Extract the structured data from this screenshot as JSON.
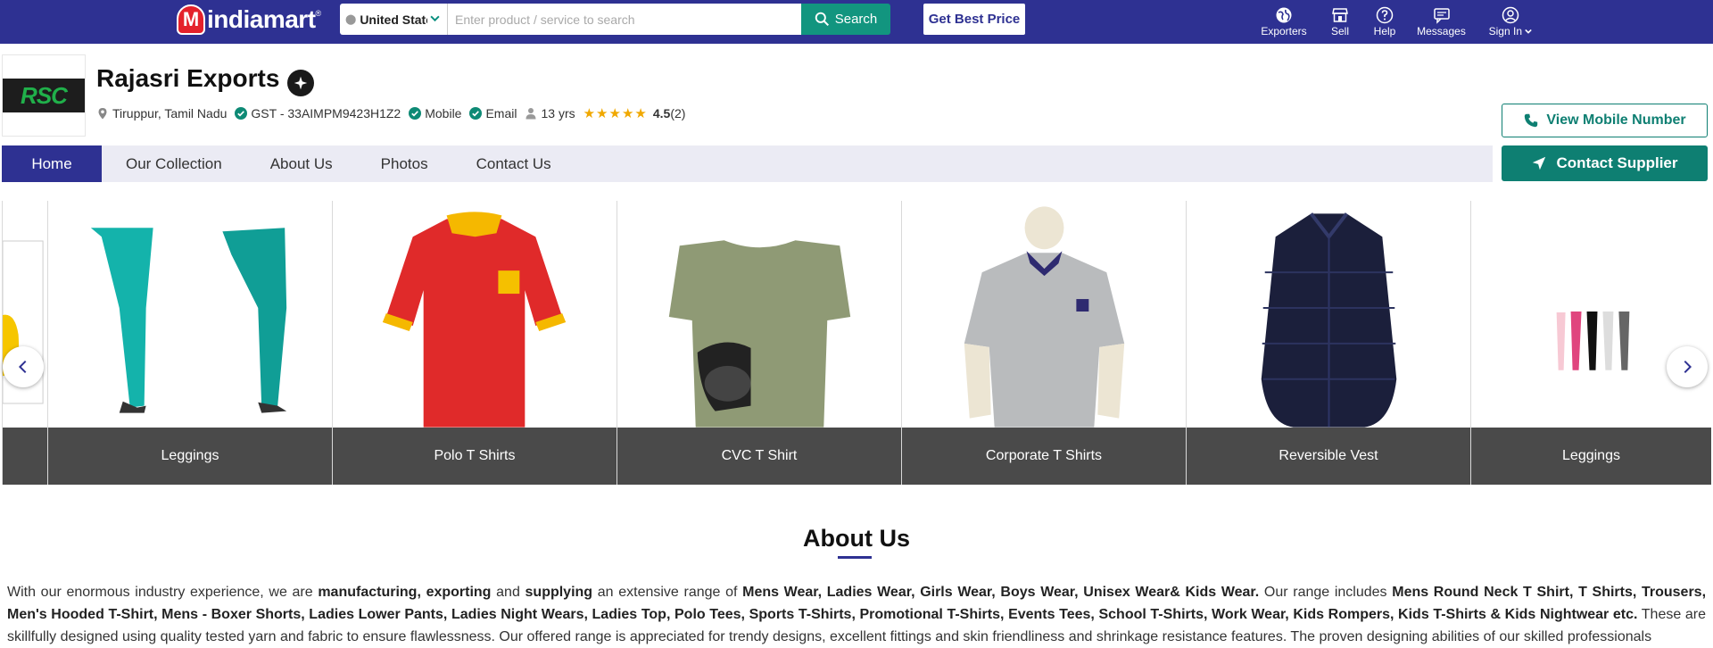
{
  "header": {
    "logo_text": "indiamart",
    "country": "United States",
    "search_placeholder": "Enter product / service to search",
    "search_label": "Search",
    "best_price_label": "Get Best Price",
    "nav": [
      {
        "label": "Exporters",
        "icon": "globe-icon"
      },
      {
        "label": "Sell",
        "icon": "store-icon"
      },
      {
        "label": "Help",
        "icon": "help-icon"
      },
      {
        "label": "Messages",
        "icon": "messages-icon"
      },
      {
        "label": "Sign In",
        "icon": "user-icon"
      }
    ]
  },
  "company": {
    "logo_text": "RSC",
    "name": "Rajasri Exports",
    "location": "Tiruppur, Tamil Nadu",
    "gst": "GST - 33AIMPM9423H1Z2",
    "mobile": "Mobile",
    "email": "Email",
    "years": "13 yrs",
    "stars": "★★★★★",
    "rating": "4.5",
    "rating_count": "(2)",
    "view_mobile_label": "View Mobile Number",
    "contact_label": "Contact Supplier"
  },
  "tabs": [
    "Home",
    "Our Collection",
    "About Us",
    "Photos",
    "Contact Us"
  ],
  "carousel": [
    "Leggings",
    "Polo T Shirts",
    "CVC T Shirt",
    "Corporate T Shirts",
    "Reversible Vest",
    "Leggings"
  ],
  "about": {
    "title": "About Us",
    "p_1": "With our enormous industry experience, we are ",
    "b_1": "manufacturing, exporting",
    "p_2": " and ",
    "b_2": "supplying",
    "p_3": " an extensive range of ",
    "b_3": "Mens Wear, Ladies Wear, Girls Wear, Boys Wear, Unisex Wear& Kids Wear.",
    "p_4": " Our range includes ",
    "b_4": "Mens Round Neck T Shirt, T Shirts, Trousers, Men's Hooded T-Shirt, Mens - Boxer Shorts, Ladies Lower Pants, Ladies Night Wears, Ladies Top, Polo Tees, Sports T-Shirts, Promotional T-Shirts, Events Tees, School T-Shirts, Work Wear, Kids Rompers, Kids T-Shirts & Kids Nightwear etc.",
    "p_5": " These are skillfully designed using quality tested yarn and fabric to ensure flawlessness. Our offered range is appreciated for trendy designs, excellent fittings and skin friendliness and shrinkage resistance features. The proven designing abilities of our skilled professionals"
  },
  "colors": {
    "brand": "#2e3192",
    "accent": "#0e7f72",
    "search_button": "#12957f",
    "star": "#f0a800"
  }
}
